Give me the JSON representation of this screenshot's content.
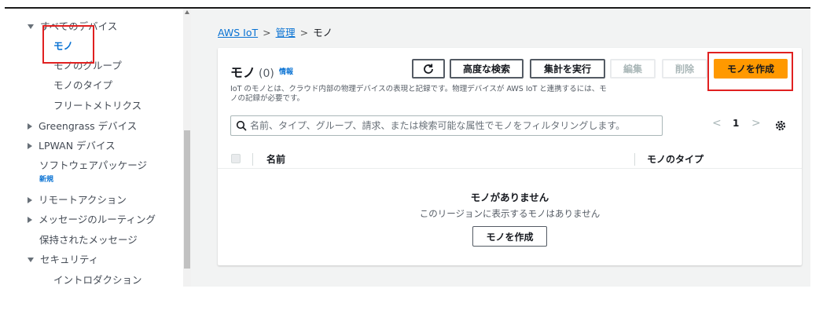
{
  "sidebar": {
    "items": [
      {
        "label": "すべてのデバイス",
        "expanded": true
      },
      {
        "label": "モノ",
        "active": true
      },
      {
        "label": "モノのグループ"
      },
      {
        "label": "モノのタイプ"
      },
      {
        "label": "フリートメトリクス"
      },
      {
        "label": "Greengrass デバイス",
        "expanded": false
      },
      {
        "label": "LPWAN デバイス",
        "expanded": false
      },
      {
        "label": "ソフトウェアパッケージ",
        "badge": "新規"
      },
      {
        "label": "リモートアクション",
        "expanded": false
      },
      {
        "label": "メッセージのルーティング",
        "expanded": false
      },
      {
        "label": "保持されたメッセージ"
      },
      {
        "label": "セキュリティ",
        "expanded": true
      },
      {
        "label": "イントロダクション"
      }
    ]
  },
  "breadcrumb": {
    "items": [
      "AWS IoT",
      "管理",
      "モノ"
    ],
    "separator": ">"
  },
  "panel": {
    "title": "モノ",
    "count": "(0)",
    "info": "情報",
    "description": "IoT のモノとは、クラウド内部の物理デバイスの表現と記録です。物理デバイスが AWS IoT と連携するには、モノの記録が必要です。",
    "buttons": {
      "refresh_icon": "refresh-icon",
      "advanced_search": "高度な検索",
      "run_aggregation": "集計を実行",
      "edit": "編集",
      "delete": "削除",
      "create": "モノを作成"
    },
    "search": {
      "placeholder": "名前、タイプ、グループ、請求、または検索可能な属性でモノをフィルタリングします。",
      "value": ""
    },
    "pagination": {
      "page": "1",
      "prev": "<",
      "next": ">"
    },
    "table": {
      "columns": [
        "名前",
        "モノのタイプ"
      ]
    },
    "empty": {
      "title": "モノがありません",
      "description": "このリージョンに表示するモノはありません",
      "button": "モノを作成"
    }
  },
  "colors": {
    "accent": "#0972d3",
    "primary_button": "#ff9900",
    "highlight": "#e02020",
    "main_bg": "#f2f3f3"
  }
}
